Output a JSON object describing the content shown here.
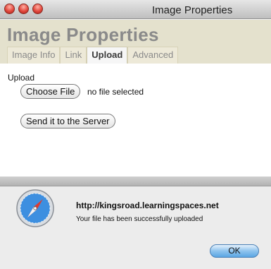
{
  "window": {
    "title": "Image Properties",
    "heading": "Image Properties",
    "tabs": [
      "Image Info",
      "Link",
      "Upload",
      "Advanced"
    ],
    "active_tab": "Upload"
  },
  "upload": {
    "label": "Upload",
    "choose_button": "Choose File",
    "file_status": "no file selected",
    "send_button": "Send it to the Server"
  },
  "alert": {
    "host": "http://kingsroad.learningspaces.net",
    "message": "Your file has been successfully uploaded",
    "ok_button": "OK"
  },
  "icons": {
    "close": "close-icon",
    "minimize": "minimize-icon",
    "zoom": "zoom-icon",
    "alert": "safari-compass-icon"
  },
  "colors": {
    "header_bg": "#e4e1cd",
    "ok_button": "#5aa6e3",
    "traffic_light": "#e2483d"
  }
}
